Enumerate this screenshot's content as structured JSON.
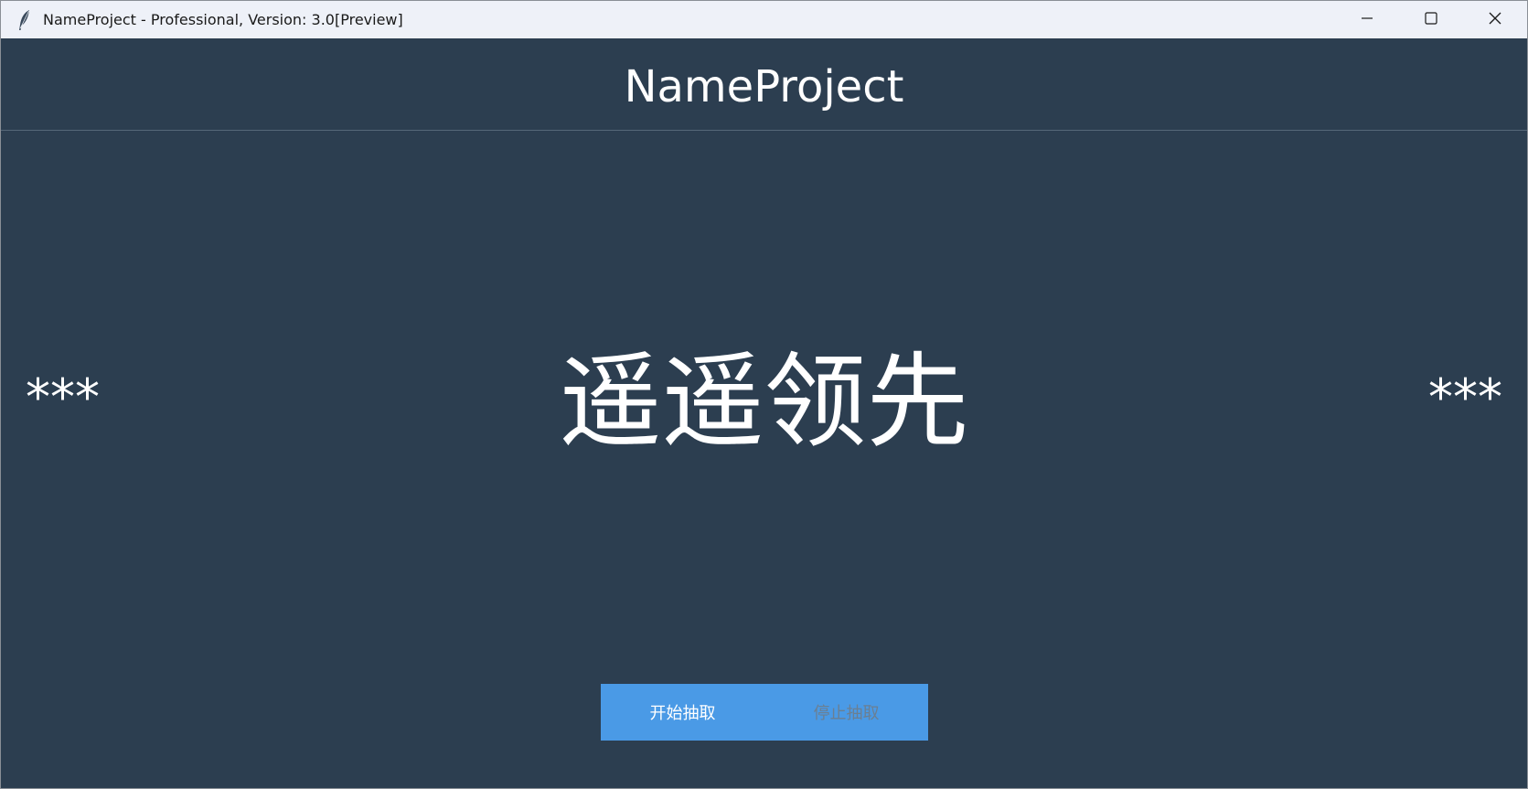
{
  "window": {
    "title": "NameProject - Professional, Version: 3.0[Preview]",
    "app_icon": "feather-icon",
    "controls": {
      "minimize": "minimize-icon",
      "maximize": "maximize-icon",
      "close": "close-icon"
    }
  },
  "header": {
    "title": "NameProject"
  },
  "display": {
    "left_name": "***",
    "center_name": "遥遥领先",
    "right_name": "***"
  },
  "actions": {
    "start_label": "开始抽取",
    "stop_label": "停止抽取"
  },
  "colors": {
    "background": "#2c3e50",
    "titlebar": "#eef1f8",
    "button_bar": "#4a9ae6",
    "start_text": "#ffffff",
    "stop_text_disabled": "#6b7f92"
  }
}
